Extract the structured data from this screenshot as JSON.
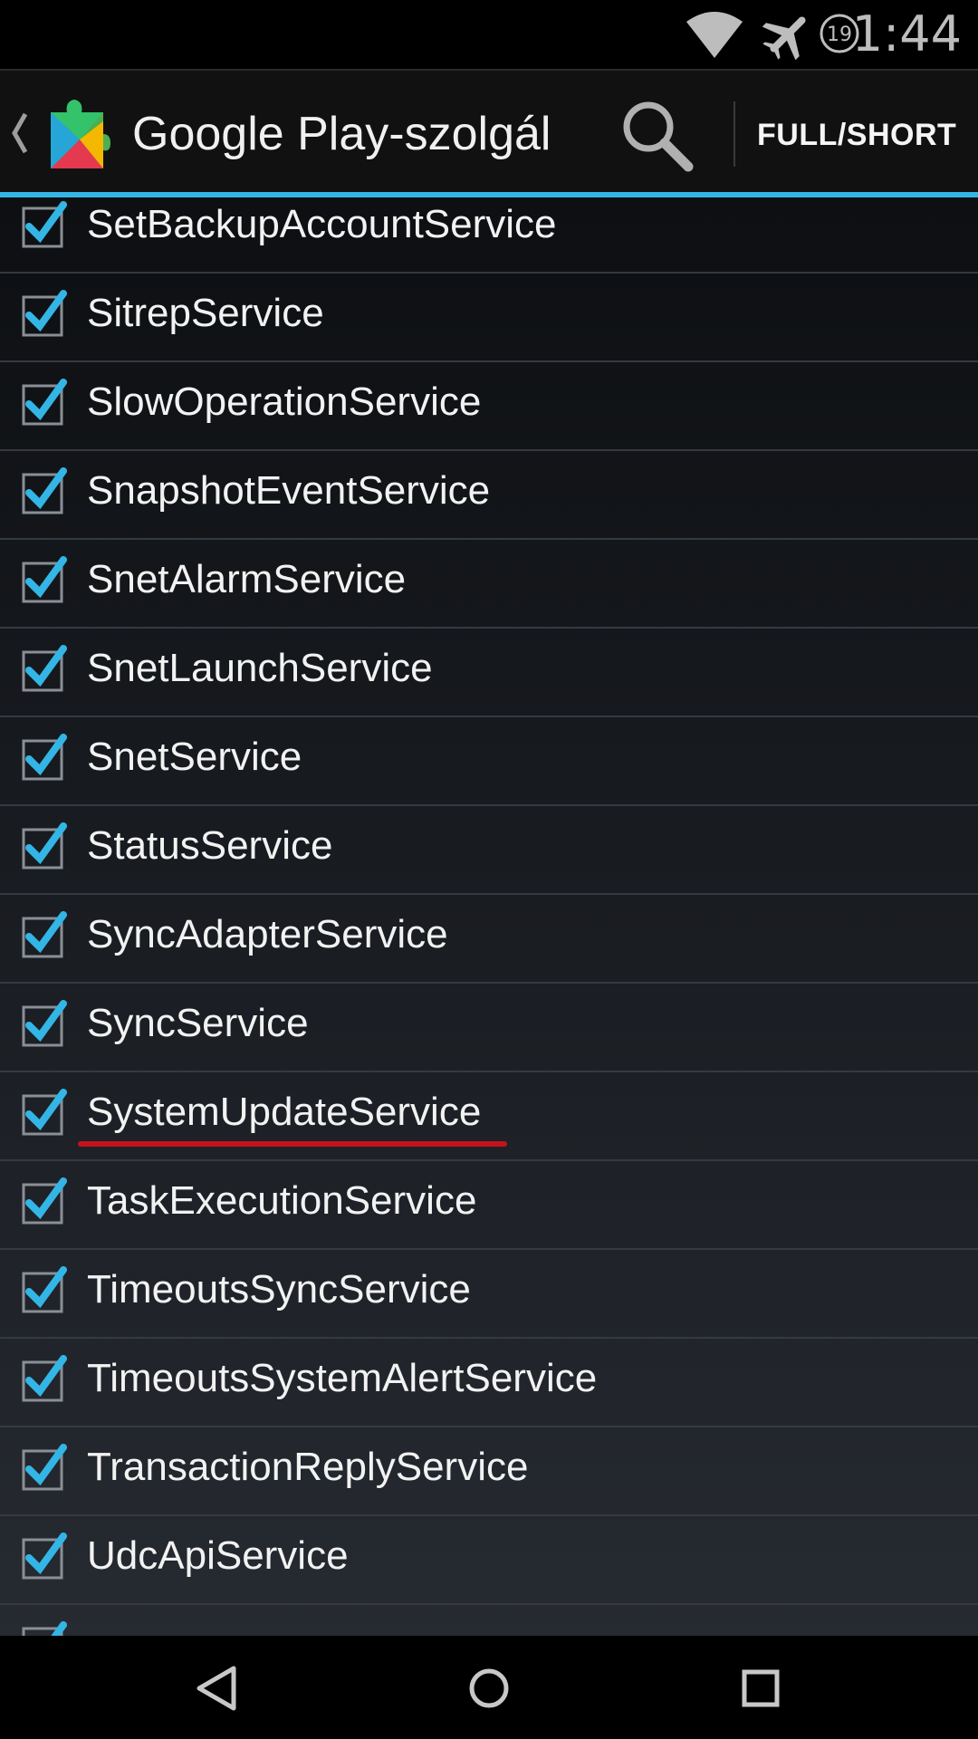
{
  "status_bar": {
    "time": "1:44",
    "alarm_badge": "19",
    "icons": [
      "wifi-icon",
      "airplane-mode-icon",
      "alarm-badge-icon"
    ]
  },
  "action_bar": {
    "title": "Google Play-szolgál",
    "full_short_label": "FULL/SHORT",
    "icons": [
      "up-caret-icon",
      "play-services-app-icon",
      "search-icon"
    ],
    "accent_color": "#33b5e5"
  },
  "services": [
    {
      "name": "SetBackupAccountService",
      "checked": true
    },
    {
      "name": "SitrepService",
      "checked": true
    },
    {
      "name": "SlowOperationService",
      "checked": true
    },
    {
      "name": "SnapshotEventService",
      "checked": true
    },
    {
      "name": "SnetAlarmService",
      "checked": true
    },
    {
      "name": "SnetLaunchService",
      "checked": true
    },
    {
      "name": "SnetService",
      "checked": true
    },
    {
      "name": "StatusService",
      "checked": true
    },
    {
      "name": "SyncAdapterService",
      "checked": true
    },
    {
      "name": "SyncService",
      "checked": true
    },
    {
      "name": "SystemUpdateService",
      "checked": true,
      "highlighted": true
    },
    {
      "name": "TaskExecutionService",
      "checked": true
    },
    {
      "name": "TimeoutsSyncService",
      "checked": true
    },
    {
      "name": "TimeoutsSystemAlertService",
      "checked": true
    },
    {
      "name": "TransactionReplyService",
      "checked": true
    },
    {
      "name": "UdcApiService",
      "checked": true
    },
    {
      "name": "",
      "checked": true
    }
  ],
  "highlight_color": "#c4121c",
  "nav_bar": {
    "icons": [
      "back-icon",
      "home-icon",
      "recents-icon"
    ]
  }
}
